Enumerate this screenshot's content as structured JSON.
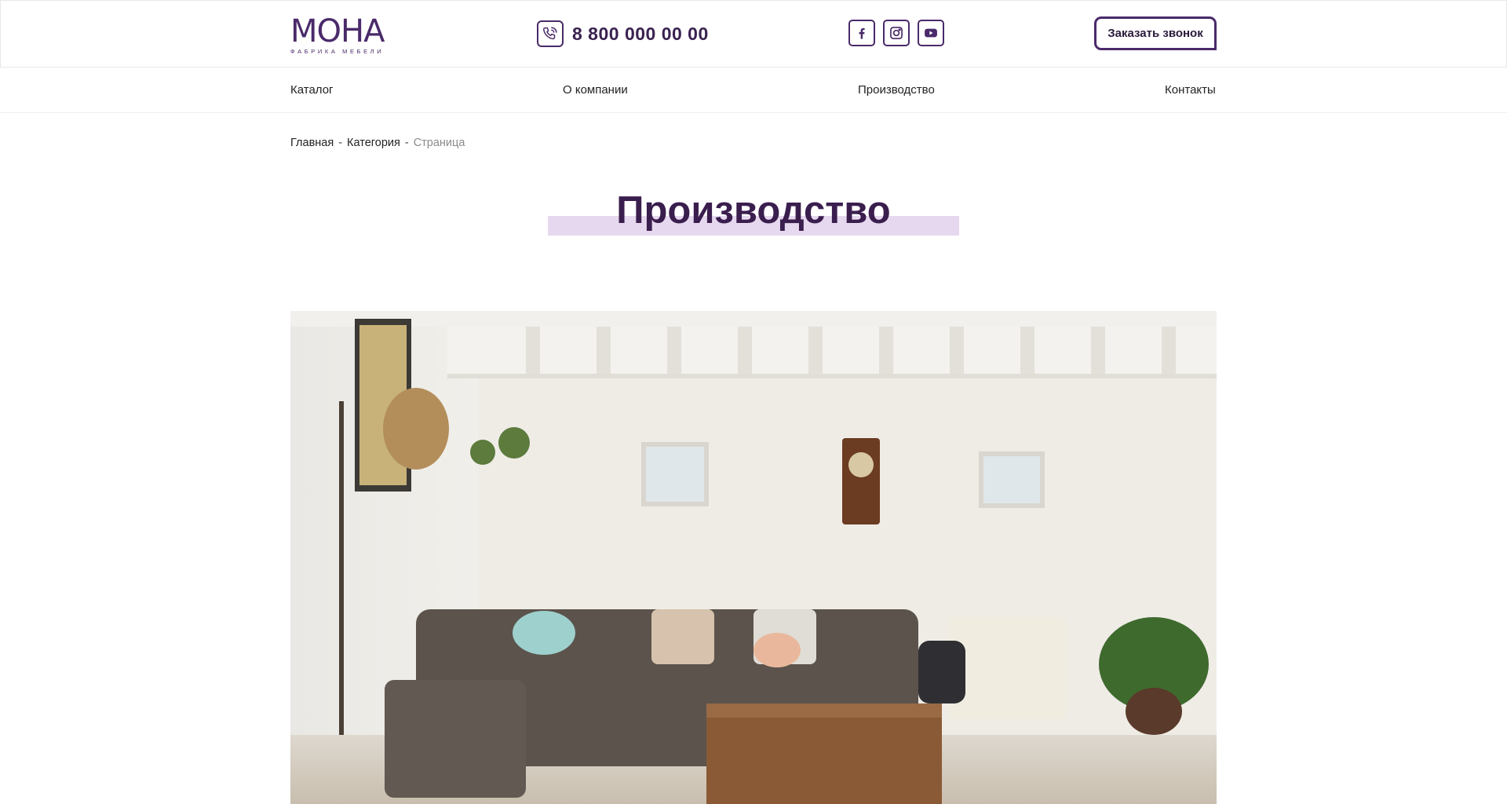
{
  "header": {
    "logo": {
      "name": "МОНА",
      "tagline": "ФАБРИКА МЕБЕЛИ"
    },
    "phone": {
      "icon": "phone-icon",
      "number": "8 800 000 00 00"
    },
    "socials": [
      {
        "icon": "facebook-icon"
      },
      {
        "icon": "instagram-icon"
      },
      {
        "icon": "youtube-icon"
      }
    ],
    "callback_label": "Заказать звонок"
  },
  "nav": {
    "items": [
      {
        "label": "Каталог"
      },
      {
        "label": "О компании"
      },
      {
        "label": "Производство"
      },
      {
        "label": "Контакты"
      }
    ]
  },
  "breadcrumb": {
    "items": [
      {
        "label": "Главная"
      },
      {
        "label": "Категория"
      }
    ],
    "separator": "-",
    "current": "Страница"
  },
  "page": {
    "title": "Производство"
  },
  "hero": {
    "image": "living-room-photo"
  },
  "colors": {
    "brand": "#4a2a6a",
    "title": "#3a1e4e",
    "title_highlight": "#e6d8ee",
    "breadcrumb_current": "#8a8a8a",
    "border": "#e8e8e8"
  }
}
